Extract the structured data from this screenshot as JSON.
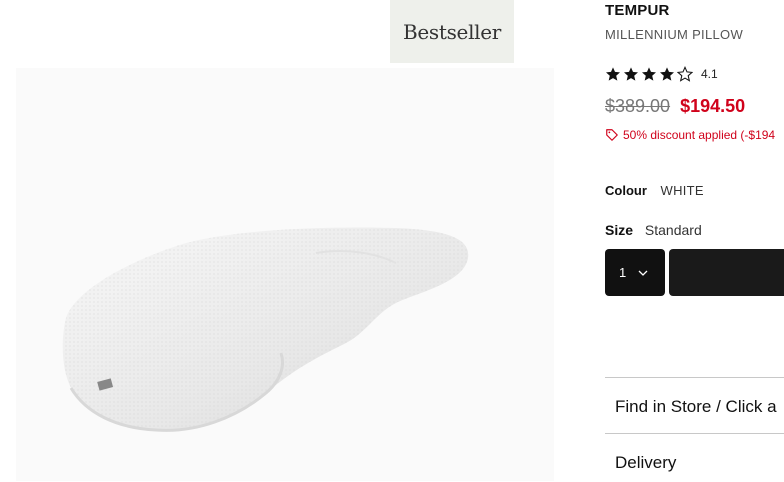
{
  "badge": {
    "label": "Bestseller"
  },
  "product": {
    "brand": "TEMPUR",
    "name": "MILLENNIUM PILLOW",
    "rating": 4.1,
    "rating_label": "4.1",
    "old_price": "$389.00",
    "sale_price": "$194.50",
    "discount_text": "50% discount applied (-$194",
    "colour_label": "Colour",
    "colour_value": "WHITE",
    "size_label": "Size",
    "size_value": "Standard",
    "quantity": "1"
  },
  "accordion": {
    "find_in_store": "Find in Store / Click a",
    "delivery": "Delivery"
  },
  "colors": {
    "sale": "#d0021b",
    "button": "#1a1a1a",
    "badge_bg": "#eef0eb"
  },
  "icons": [
    "star-filled-icon",
    "star-outline-icon",
    "price-tag-icon",
    "chevron-down-icon"
  ]
}
